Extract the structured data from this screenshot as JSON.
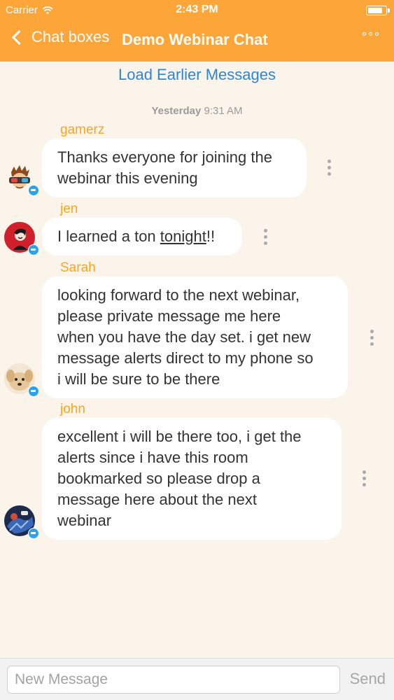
{
  "status_bar": {
    "carrier": "Carrier",
    "time": "2:43 PM"
  },
  "nav": {
    "back_label": "Chat boxes",
    "title": "Demo Webinar Chat"
  },
  "load_earlier": "Load Earlier Messages",
  "timestamp": {
    "day": "Yesterday",
    "time": "9:31 AM"
  },
  "messages": [
    {
      "sender": "gamerz",
      "lines": [
        "Thanks everyone for joining the",
        "webinar this evening"
      ]
    },
    {
      "sender": "jen",
      "text_before": "I learned a ton ",
      "text_link": "tonight",
      "text_after": "!!"
    },
    {
      "sender": "Sarah",
      "lines": [
        "looking forward to the next webinar,",
        "please private message me here",
        "when you have the day set. i get new",
        "message alerts direct to my phone so",
        "i will be sure to be there"
      ]
    },
    {
      "sender": "john",
      "lines": [
        "excellent i will be there too, i get the",
        "alerts since i have this room",
        "bookmarked so please drop a",
        "message here about the next",
        "webinar"
      ]
    }
  ],
  "composer": {
    "placeholder": "New Message",
    "value": "",
    "send_label": "Send"
  },
  "colors": {
    "header": "#fca63a",
    "background": "#fbf4ea",
    "sender": "#f5a623",
    "link": "#2d86d4"
  }
}
